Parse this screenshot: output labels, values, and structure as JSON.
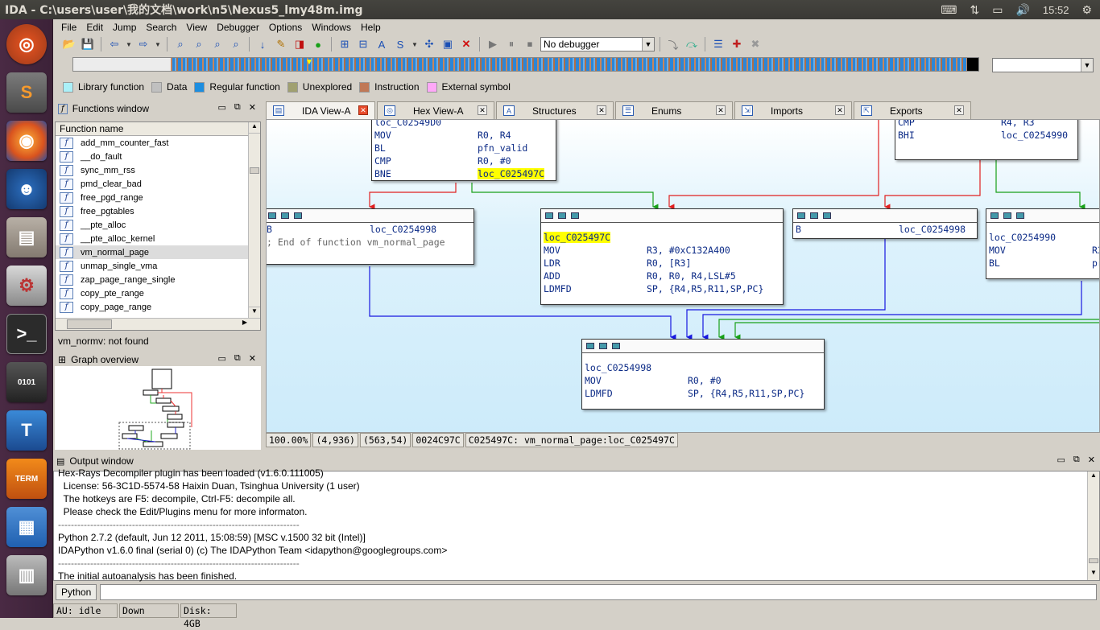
{
  "window": {
    "title": "IDA - C:\\users\\user\\我的文档\\work\\n5\\Nexus5_lmy48m.img"
  },
  "tray": {
    "keyboard_icon": "keyboard-icon",
    "network_icon": "network-arrows-icon",
    "battery_icon": "battery-icon",
    "volume_icon": "volume-icon",
    "time": "15:52",
    "power_icon": "gear-icon"
  },
  "launcher": [
    "ubuntu-icon",
    "sublime-icon",
    "firefox-icon",
    "qq-icon",
    "files-icon",
    "settings-icon",
    "terminal-icon",
    "binary-editor-icon",
    "tex-icon",
    "term-stack-icon"
  ],
  "menu": [
    "File",
    "Edit",
    "Jump",
    "Search",
    "View",
    "Debugger",
    "Options",
    "Windows",
    "Help"
  ],
  "toolbar": {
    "debugger_select": "No debugger"
  },
  "legend": [
    {
      "label": "Library function",
      "color": "#aaf0f8"
    },
    {
      "label": "Data",
      "color": "#c0c0c0"
    },
    {
      "label": "Regular function",
      "color": "#1c8ee0"
    },
    {
      "label": "Unexplored",
      "color": "#a0a070"
    },
    {
      "label": "Instruction",
      "color": "#c07856"
    },
    {
      "label": "External symbol",
      "color": "#ffa8f8"
    }
  ],
  "functions_window": {
    "title": "Functions window",
    "header": "Function name",
    "items": [
      "add_mm_counter_fast",
      "__do_fault",
      "sync_mm_rss",
      "pmd_clear_bad",
      "free_pgd_range",
      "free_pgtables",
      "__pte_alloc",
      "__pte_alloc_kernel",
      "vm_normal_page",
      "unmap_single_vma",
      "zap_page_range_single",
      "copy_pte_range",
      "copy_page_range"
    ],
    "selected": "vm_normal_page",
    "search_status": "vm_normv: not found"
  },
  "graph_overview": {
    "title": "Graph overview"
  },
  "tabs": [
    {
      "label": "IDA View-A",
      "active": true
    },
    {
      "label": "Hex View-A",
      "active": false
    },
    {
      "label": "Structures",
      "active": false
    },
    {
      "label": "Enums",
      "active": false
    },
    {
      "label": "Imports",
      "active": false
    },
    {
      "label": "Exports",
      "active": false
    }
  ],
  "nodes": {
    "top_left": {
      "partial": "loc_C02549D0",
      "lines": [
        [
          "MOV",
          "R0, R4"
        ],
        [
          "BL",
          "pfn_valid"
        ],
        [
          "CMP",
          "R0, #0"
        ],
        [
          "BNE",
          "loc_C025497C"
        ]
      ]
    },
    "top_right": {
      "lines": [
        [
          "CMP",
          "R4, R3"
        ],
        [
          "BHI",
          "loc_C0254990"
        ]
      ]
    },
    "n1": {
      "line1_op": "B",
      "line1_arg": "loc_C0254998",
      "comment": "; End of function vm_normal_page"
    },
    "n2": {
      "label": "loc_C025497C",
      "lines": [
        [
          "MOV",
          "R3, #0xC132A400"
        ],
        [
          "LDR",
          "R0, [R3]"
        ],
        [
          "ADD",
          "R0, R0, R4,LSL#5"
        ],
        [
          "LDMFD",
          "SP, {R4,R5,R11,SP,PC}"
        ]
      ]
    },
    "n3": {
      "line1_op": "B",
      "line1_arg": "loc_C0254998"
    },
    "n4": {
      "label": "loc_C0254990",
      "lines": [
        [
          "MOV",
          "R3"
        ],
        [
          "BL",
          "pr"
        ]
      ]
    },
    "n5": {
      "label": "loc_C0254998",
      "lines": [
        [
          "MOV",
          "R0, #0"
        ],
        [
          "LDMFD",
          "SP, {R4,R5,R11,SP,PC}"
        ]
      ]
    }
  },
  "graph_status": [
    "100.00%",
    "(4,936)",
    "(563,54)",
    "0024C97C",
    "C025497C: vm_normal_page:loc_C025497C"
  ],
  "output_window": {
    "title": "Output window",
    "lines": [
      "Hex-Rays Decompiler plugin has been loaded (v1.6.0.111005)",
      "  License: 56-3C1D-5574-58 Haixin Duan, Tsinghua University (1 user)",
      "  The hotkeys are F5: decompile, Ctrl-F5: decompile all.",
      "  Please check the Edit/Plugins menu for more informaton.",
      "---------------------------------------------------------------------------",
      "Python 2.7.2 (default, Jun 12 2011, 15:08:59) [MSC v.1500 32 bit (Intel)]",
      "IDAPython v1.6.0 final (serial 0) (c) The IDAPython Team <idapython@googlegroups.com>",
      "---------------------------------------------------------------------------",
      "The initial autoanalysis has been finished."
    ]
  },
  "python_button": "Python",
  "status": {
    "au": "AU:  idle",
    "dir": "Down",
    "disk": "Disk: 4GB"
  }
}
